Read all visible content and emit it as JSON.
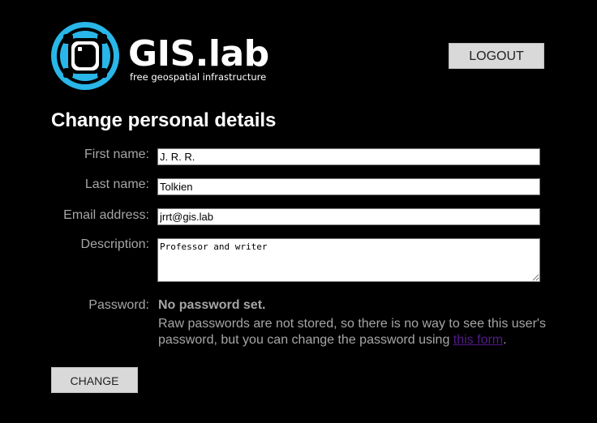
{
  "header": {
    "logo_title": "GIS.lab",
    "logo_tagline": "free geospatial infrastructure",
    "logout_label": "LOGOUT"
  },
  "page": {
    "title": "Change personal details"
  },
  "form": {
    "first_name": {
      "label": "First name:",
      "value": "J. R. R."
    },
    "last_name": {
      "label": "Last name:",
      "value": "Tolkien"
    },
    "email": {
      "label": "Email address:",
      "value": "jrrt@gis.lab"
    },
    "description": {
      "label": "Description:",
      "value": "Professor and writer"
    },
    "password": {
      "label": "Password:",
      "status": "No password set.",
      "help_before_link": "Raw passwords are not stored, so there is no way to see this user's password, but you can change the password using ",
      "link_text": "this form",
      "help_after_link": "."
    },
    "submit_label": "CHANGE"
  },
  "colors": {
    "background": "#000000",
    "logo_blue": "#29b6e8",
    "label_gray": "#a6a6a6",
    "button_gray": "#d9d9d9",
    "link_visited": "#551a8b"
  },
  "icons": {
    "logo": "gislab-logo-icon"
  }
}
